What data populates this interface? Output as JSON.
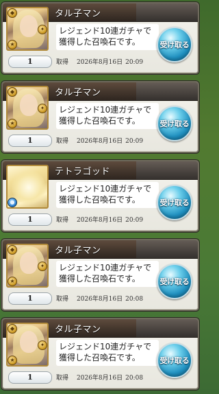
{
  "items": [
    {
      "name": "タル子マン",
      "description": "レジェンド10連ガチャで獲得した召喚石です。",
      "quantity": "1",
      "acquired_label": "取得",
      "date": "2026年8月16日",
      "time": "20:09",
      "button_label": "受け取る",
      "thumbnail": "tarukoman",
      "badge": "gold"
    },
    {
      "name": "タル子マン",
      "description": "レジェンド10連ガチャで獲得した召喚石です。",
      "quantity": "1",
      "acquired_label": "取得",
      "date": "2026年8月16日",
      "time": "20:09",
      "button_label": "受け取る",
      "thumbnail": "tarukoman",
      "badge": "gold"
    },
    {
      "name": "テトラゴッド",
      "description": "レジェンド10連ガチャで獲得した召喚石です。",
      "quantity": "1",
      "acquired_label": "取得",
      "date": "2026年8月16日",
      "time": "20:09",
      "button_label": "受け取る",
      "thumbnail": "tetragod",
      "badge": "blue"
    },
    {
      "name": "タル子マン",
      "description": "レジェンド10連ガチャで獲得した召喚石です。",
      "quantity": "1",
      "acquired_label": "取得",
      "date": "2026年8月16日",
      "time": "20:08",
      "button_label": "受け取る",
      "thumbnail": "tarukoman",
      "badge": "gold"
    },
    {
      "name": "タル子マン",
      "description": "レジェンド10連ガチャで獲得した召喚石です。",
      "quantity": "1",
      "acquired_label": "取得",
      "date": "2026年8月16日",
      "time": "20:08",
      "button_label": "受け取る",
      "thumbnail": "tarukoman",
      "badge": "gold"
    }
  ],
  "colors": {
    "title_bar": "#43362c",
    "receive_button": "#1f8fbf",
    "frame_gold": "#b08a3a",
    "background_green": "#4a7a36"
  }
}
